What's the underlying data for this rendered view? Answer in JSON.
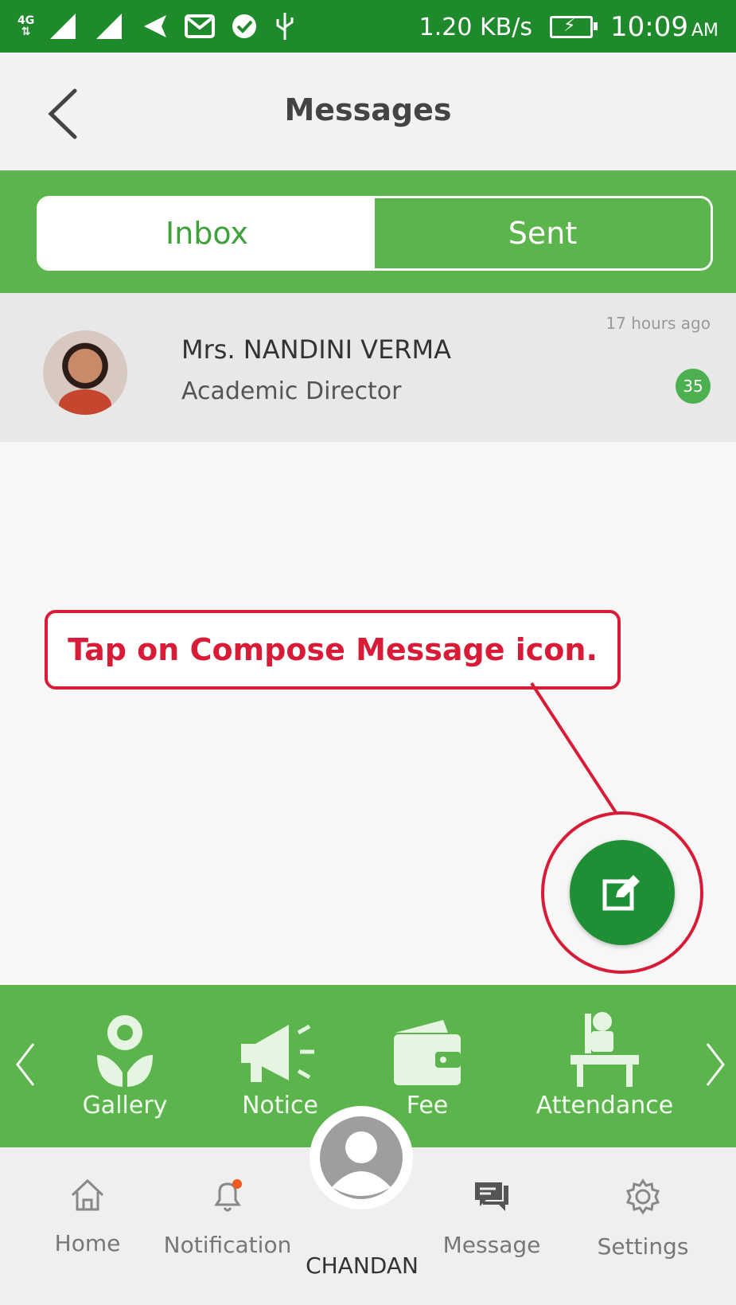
{
  "status_bar": {
    "network_label": "4G",
    "speed": "1.20 KB/s",
    "time": "10:09",
    "ampm": "AM"
  },
  "header": {
    "title": "Messages"
  },
  "tabs": {
    "inbox": "Inbox",
    "sent": "Sent",
    "selected": "Inbox"
  },
  "messages": [
    {
      "name": "Mrs. NANDINI VERMA",
      "role": "Academic Director",
      "time": "17 hours ago",
      "unread": "35"
    }
  ],
  "annotation": {
    "text": "Tap on Compose Message icon."
  },
  "features": [
    {
      "label": "Gallery",
      "icon": "flower-icon"
    },
    {
      "label": "Notice",
      "icon": "megaphone-icon"
    },
    {
      "label": "Fee",
      "icon": "wallet-icon"
    },
    {
      "label": "Attendance",
      "icon": "desk-icon"
    }
  ],
  "bottom_nav": {
    "home": "Home",
    "notification": "Notification",
    "user": "CHANDAN",
    "message": "Message",
    "settings": "Settings"
  },
  "colors": {
    "status_bar": "#1f8a2c",
    "primary_green": "#5cb54c",
    "fab_green": "#1f8f36",
    "annotation_red": "#d81b36"
  }
}
